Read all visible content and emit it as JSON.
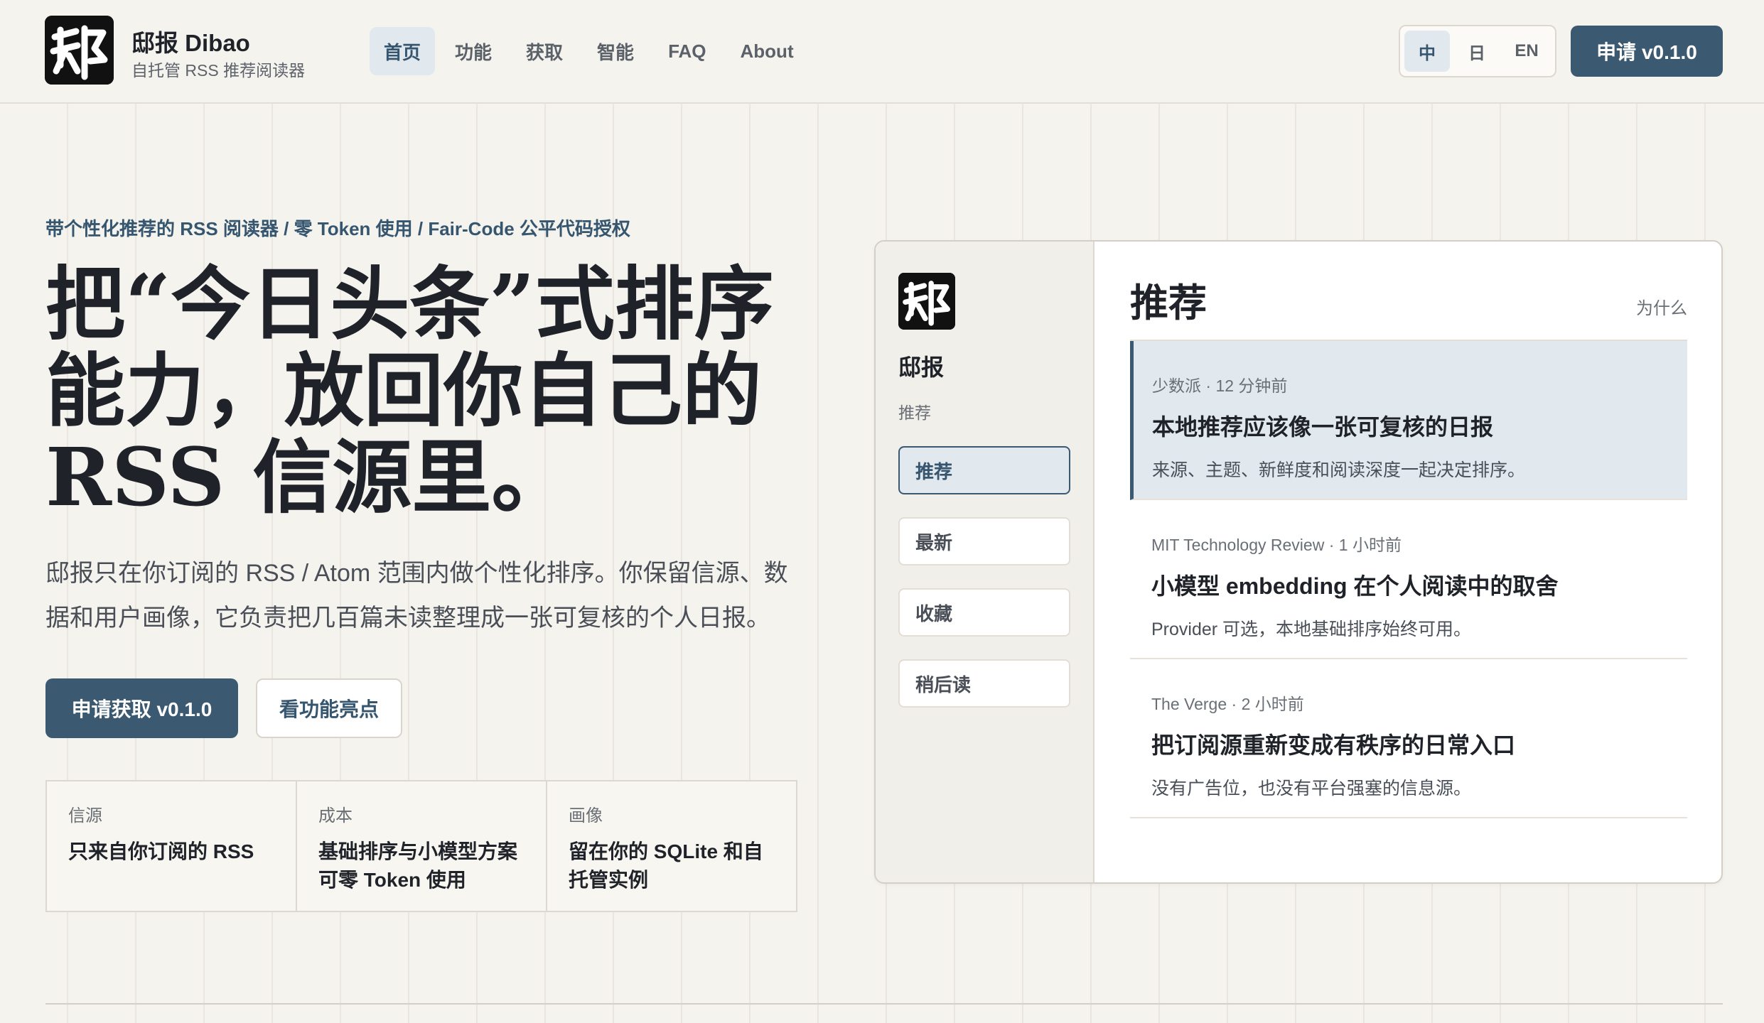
{
  "header": {
    "brand_name": "邸报 Dibao",
    "brand_tagline": "自托管 RSS 推荐阅读器",
    "nav": [
      "首页",
      "功能",
      "获取",
      "智能",
      "FAQ",
      "About"
    ],
    "languages": [
      "中",
      "日",
      "EN"
    ],
    "apply_label": "申请 v0.1.0"
  },
  "hero": {
    "eyebrow": "带个性化推荐的 RSS 阅读器 / 零 Token 使用 / Fair-Code 公平代码授权",
    "headline_lines": [
      "把“今日头条”式排序",
      "能力，放回你自己的",
      "RSS 信源里。"
    ],
    "lead": "邸报只在你订阅的 RSS / Atom 范围内做个性化排序。你保留信源、数据和用户画像，它负责把几百篇未读整理成一张可复核的个人日报。",
    "cta_primary": "申请获取 v0.1.0",
    "cta_secondary": "看功能亮点",
    "facts": [
      {
        "label": "信源",
        "value": "只来自你订阅的 RSS"
      },
      {
        "label": "成本",
        "value": "基础排序与小模型方案可零 Token 使用"
      },
      {
        "label": "画像",
        "value": "留在你的 SQLite 和自托管实例"
      }
    ]
  },
  "mockup": {
    "app_name": "邸报",
    "section_label": "推荐",
    "nav": [
      "推荐",
      "最新",
      "收藏",
      "稍后读"
    ],
    "title": "推荐",
    "why_label": "为什么",
    "cards": [
      {
        "meta": "少数派 · 12 分钟前",
        "headline": "本地推荐应该像一张可复核的日报",
        "summary": "来源、主题、新鲜度和阅读深度一起决定排序。"
      },
      {
        "meta": "MIT Technology Review · 1 小时前",
        "headline": "小模型 embedding 在个人阅读中的取舍",
        "summary": "Provider 可选，本地基础排序始终可用。"
      },
      {
        "meta": "The Verge · 2 小时前",
        "headline": "把订阅源重新变成有秩序的日常入口",
        "summary": "没有广告位，也没有平台强塞的信息源。"
      }
    ]
  },
  "colors": {
    "accent": "#3b5a71",
    "accent_soft": "#e1e8ee",
    "background": "#f5f3ee"
  },
  "icons": {
    "brand_logo": "dibao-seal-logo"
  }
}
